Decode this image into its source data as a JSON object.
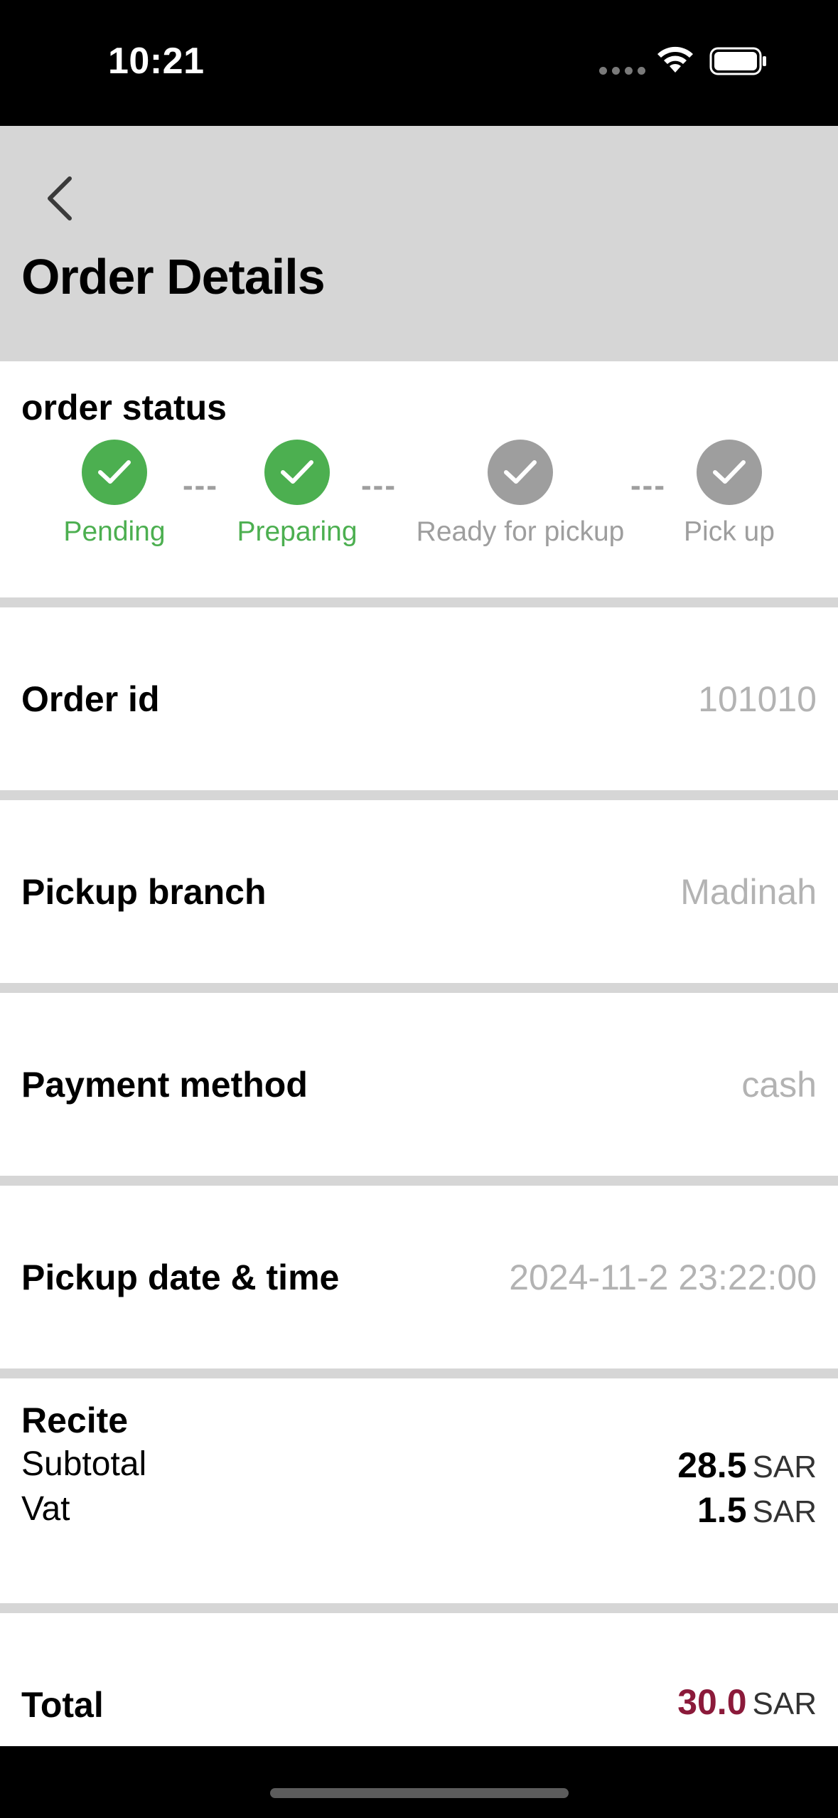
{
  "status_bar": {
    "time": "10:21"
  },
  "header": {
    "title": "Order Details"
  },
  "order_status": {
    "heading": "order status",
    "steps": [
      {
        "label": "Pending",
        "state": "done"
      },
      {
        "label": "Preparing",
        "state": "done"
      },
      {
        "label": "Ready for pickup",
        "state": "todo"
      },
      {
        "label": "Pick up",
        "state": "todo"
      }
    ],
    "connector": "---"
  },
  "details": {
    "order_id": {
      "label": "Order id",
      "value": "101010"
    },
    "pickup_branch": {
      "label": "Pickup branch",
      "value": "Madinah"
    },
    "payment_method": {
      "label": "Payment method",
      "value": "cash"
    },
    "pickup_datetime": {
      "label": "Pickup date & time",
      "value": "2024-11-2 23:22:00"
    }
  },
  "receipt": {
    "title": "Recite",
    "subtotal": {
      "label": "Subtotal",
      "amount": "28.5",
      "currency": "SAR"
    },
    "vat": {
      "label": "Vat",
      "amount": "1.5",
      "currency": "SAR"
    }
  },
  "total": {
    "label": "Total",
    "amount": "30.0",
    "currency": "SAR"
  },
  "colors": {
    "done": "#4caf50",
    "pending": "#9e9e9e",
    "header_bg": "#d6d6d6",
    "total_accent": "#8b1a3a",
    "value_gray": "#b3b3b3"
  }
}
